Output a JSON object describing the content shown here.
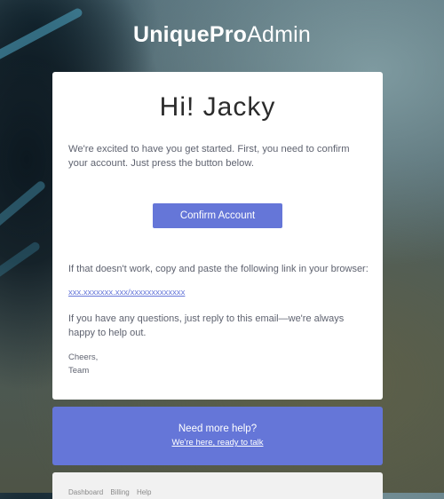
{
  "brand": {
    "name_bold": "UniquePro",
    "name_light": "Admin"
  },
  "email": {
    "greeting": "Hi! Jacky",
    "intro": "We're excited to have you get started. First, you need to confirm your account. Just press the button below.",
    "confirm_button": "Confirm Account",
    "fallback_text": "If that doesn't work, copy and paste the following link in your browser:",
    "confirm_link": "xxx.xxxxxxx.xxx/xxxxxxxxxxxxx",
    "questions_text": "If you have any questions, just reply to this email—we're always happy to help out.",
    "signoff": "Cheers,",
    "signature": "Team"
  },
  "help": {
    "title": "Need more help?",
    "link": "We're here, ready to talk"
  },
  "footer": {
    "links": [
      "Dashboard",
      "Billing",
      "Help"
    ]
  }
}
